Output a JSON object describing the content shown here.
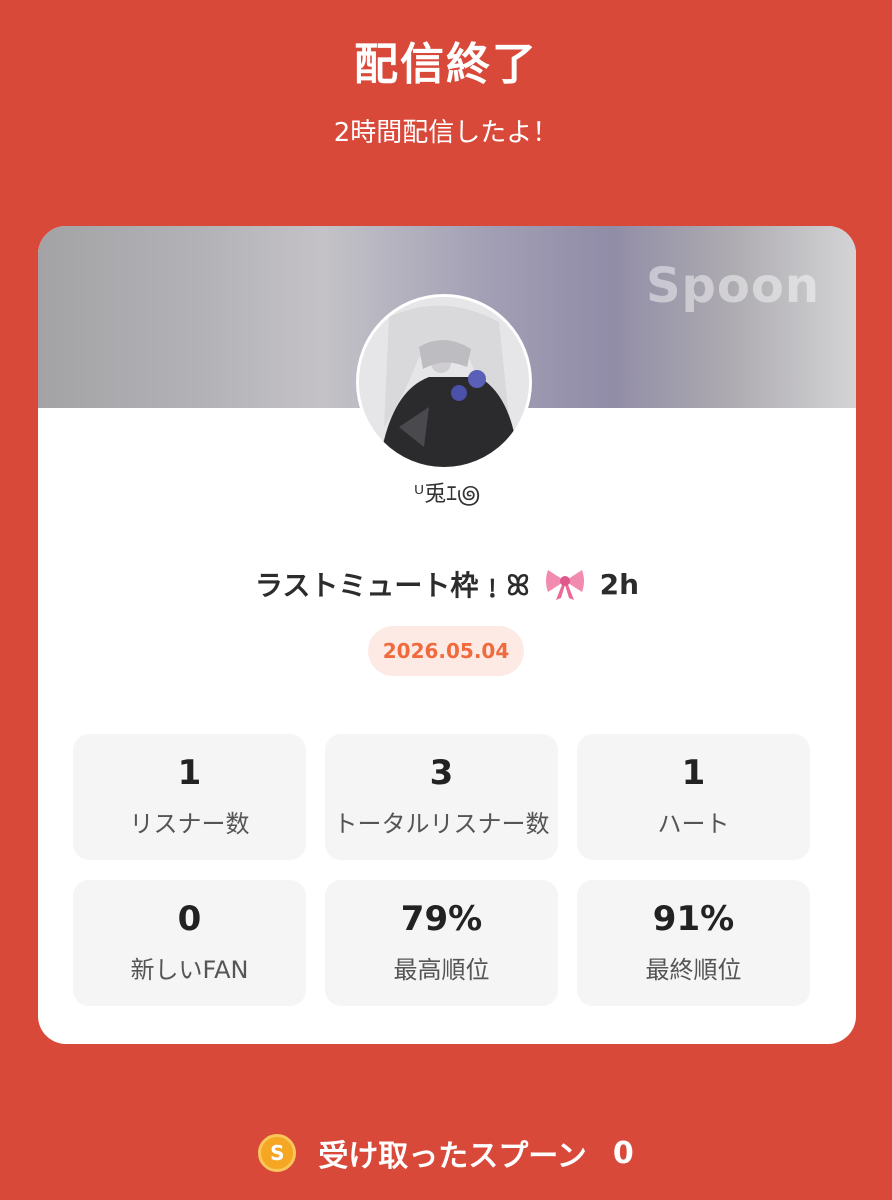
{
  "header": {
    "title": "配信終了",
    "subtitle": "2時間配信したよ！"
  },
  "card": {
    "brand": "Spoon",
    "username": "ᵁ兎ｴ౷",
    "stream_title": "ラストミュート枠﹗ꕤ",
    "duration": "2h",
    "date": "2026.05.04"
  },
  "stats": [
    {
      "value": "1",
      "label": "リスナー数"
    },
    {
      "value": "3",
      "label": "トータルリスナー数"
    },
    {
      "value": "1",
      "label": "ハート"
    },
    {
      "value": "0",
      "label": "新しいFAN"
    },
    {
      "value": "79%",
      "label": "最高順位"
    },
    {
      "value": "91%",
      "label": "最終順位"
    }
  ],
  "footer": {
    "coin_symbol": "S",
    "label": "受け取ったスプーン",
    "value": "0"
  },
  "colors": {
    "background": "#d9493a",
    "date_text": "#f06a3e",
    "date_bg": "#fdeae4",
    "coin": "#f5a623"
  },
  "icons": {
    "bow": "ribbon-icon",
    "coin": "spoon-coin-icon"
  }
}
